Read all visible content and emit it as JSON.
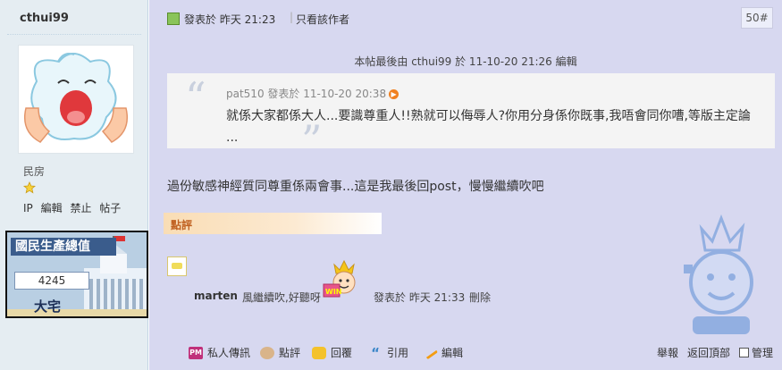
{
  "sidebar": {
    "author": "cthui99",
    "usergroup": "民房",
    "links": [
      "IP",
      "編輯",
      "禁止",
      "帖子"
    ],
    "ad": {
      "title": "國民生產總值",
      "value": "4245",
      "label": "大宅"
    }
  },
  "post": {
    "posted_time": "發表於 昨天 21:23",
    "only_author": "只看該作者",
    "floor": "50#",
    "edit_note": "本帖最後由 cthui99 於 11-10-20 21:26 編輯",
    "quote": {
      "meta": "pat510 發表於 11-10-20 20:38",
      "body": "就係大家都係大人...要識尊重人!!熟就可以侮辱人?你用分身係你既事,我唔會同你嘈,等版主定論 ..."
    },
    "body": "過份敏感神經質同尊重係兩會事...這是我最後回post，慢慢繼續吹吧",
    "rate_label": "點評",
    "comment": {
      "author": "marten",
      "text": "風繼續吹,好聽呀",
      "time": "發表於 昨天 21:33",
      "delete": "刪除"
    },
    "actions": {
      "pm": "私人傳訊",
      "rate": "點評",
      "reply": "回覆",
      "quote": "引用",
      "edit": "編輯"
    },
    "right_links": {
      "report": "舉報",
      "top": "返回頂部",
      "manage": "管理"
    }
  },
  "colors": {
    "sidebar_bg": "#e5edf2",
    "post_bg": "#d7d8f0",
    "quote_bg": "#f4f4f4"
  }
}
